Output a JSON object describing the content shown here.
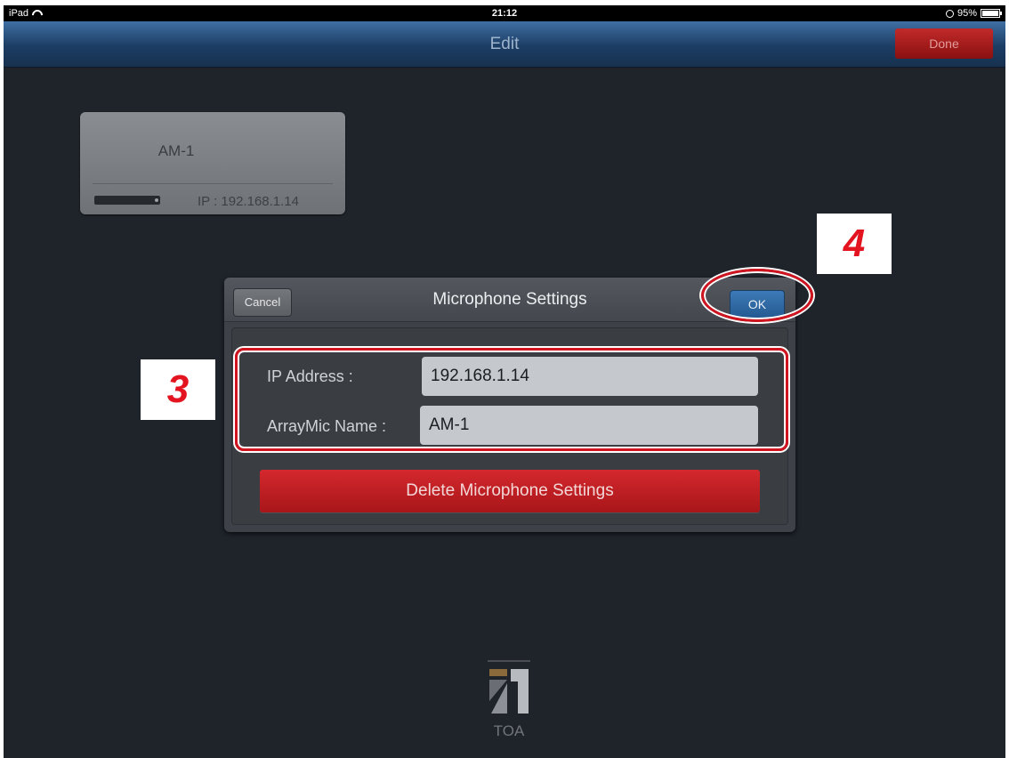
{
  "statusbar": {
    "device": "iPad",
    "time": "21:12",
    "battery": "95%"
  },
  "navbar": {
    "title": "Edit",
    "done_label": "Done"
  },
  "device_card": {
    "name": "AM-1",
    "ip": "IP : 192.168.1.14"
  },
  "markers": {
    "step3": "3",
    "step4": "4"
  },
  "dialog": {
    "title": "Microphone Settings",
    "cancel_label": "Cancel",
    "ok_label": "OK",
    "ip_label": "IP Address :",
    "ip_value": "192.168.1.14",
    "name_label": "ArrayMic Name :",
    "name_value": "AM-1",
    "delete_label": "Delete Microphone Settings"
  },
  "logo": {
    "text": "TOA"
  },
  "colors": {
    "highlight": "#d01420",
    "ok_blue": "#2f6aa6",
    "delete_red": "#c11f24",
    "navbar": "#1c3d63"
  }
}
